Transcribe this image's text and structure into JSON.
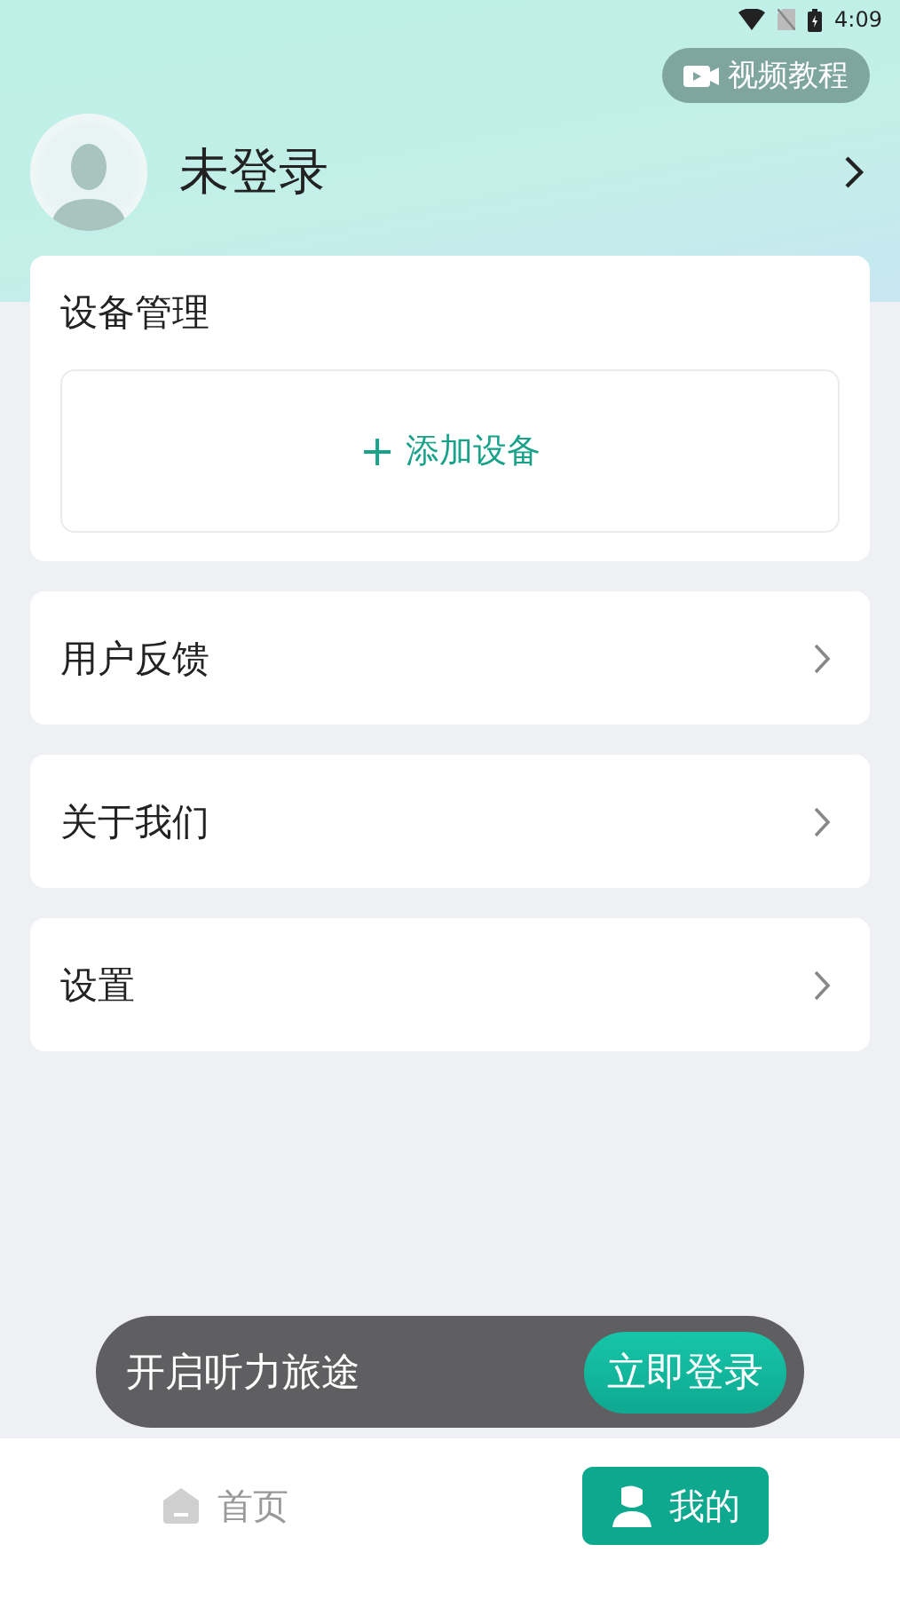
{
  "status_bar": {
    "time": "4:09"
  },
  "video_tutorial": {
    "label": "视频教程"
  },
  "profile": {
    "name": "未登录"
  },
  "device_card": {
    "title": "设备管理",
    "add_icon": "+",
    "add_label": "添加设备"
  },
  "menu": [
    {
      "label": "用户反馈"
    },
    {
      "label": "关于我们"
    },
    {
      "label": "设置"
    }
  ],
  "login_banner": {
    "text": "开启听力旅途",
    "button": "立即登录"
  },
  "tabs": [
    {
      "label": "首页",
      "kind": "home",
      "selected": false
    },
    {
      "label": "我的",
      "kind": "me",
      "selected": true
    }
  ]
}
